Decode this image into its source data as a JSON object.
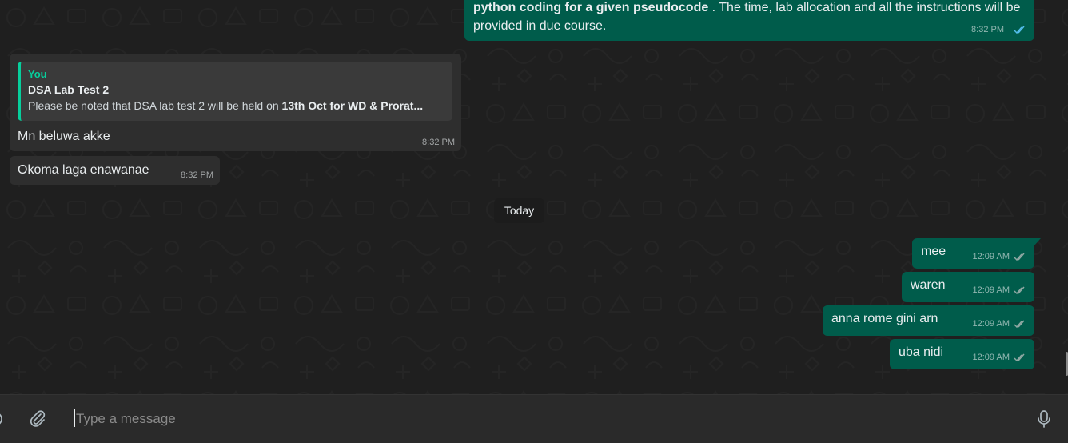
{
  "messages": {
    "top": {
      "bold_text": "python coding for a given pseudocode",
      "text": " . The time, lab allocation and all the instructions will be provided in due course.",
      "time": "8:32 PM"
    },
    "quoted": {
      "author": "You",
      "title": "DSA Lab Test 2",
      "body_prefix": "Please be noted that DSA lab test 2 will be held on ",
      "body_bold": "13th Oct for WD & Prorat...",
      "text": "Mn beluwa akke",
      "time": "8:32 PM"
    },
    "okoma": {
      "text": "Okoma laga enawanae",
      "time": "8:32 PM"
    },
    "date_chip": "Today",
    "outgoing": [
      {
        "text": "mee",
        "time": "12:09 AM"
      },
      {
        "text": "waren",
        "time": "12:09 AM"
      },
      {
        "text": "anna rome gini arn",
        "time": "12:09 AM"
      },
      {
        "text": "uba nidi",
        "time": "12:09 AM"
      }
    ]
  },
  "composer": {
    "placeholder": "Type a message",
    "attach_icon": "paperclip-icon",
    "mic_icon": "microphone-icon",
    "emoji_icon": "emoji-icon"
  },
  "colors": {
    "outgoing_bubble": "#005c4b",
    "incoming_bubble": "#2e2e2e",
    "chat_background": "#1f1f1f",
    "accent": "#06cf9c",
    "read_ticks": "#53bdeb"
  }
}
